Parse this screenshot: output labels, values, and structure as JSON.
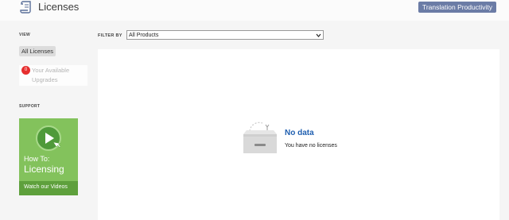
{
  "header": {
    "title": "Licenses",
    "product_button": "Translation Productivity"
  },
  "sidebar": {
    "view_heading": "VIEW",
    "all_licenses": "All Licenses",
    "upgrades": {
      "count": "0",
      "label": "Your Available Upgrades"
    },
    "support_heading": "SUPPORT",
    "video": {
      "line1": "How To:",
      "line2": "Licensing",
      "cta": "Watch our Videos"
    }
  },
  "filter": {
    "label": "FILTER BY",
    "selected": "All Products"
  },
  "empty_state": {
    "title": "No data",
    "message": "You have no licenses"
  },
  "icons": {
    "logo": "scroll-document-icon",
    "video": "play-icon",
    "dropdown": "chevron-down-icon",
    "empty": "empty-box-icon"
  },
  "colors": {
    "product_button": "#6b7ca6",
    "badge": "#e62e2e",
    "video_tile": "#83c25c",
    "no_data_title": "#1f5fb0"
  }
}
